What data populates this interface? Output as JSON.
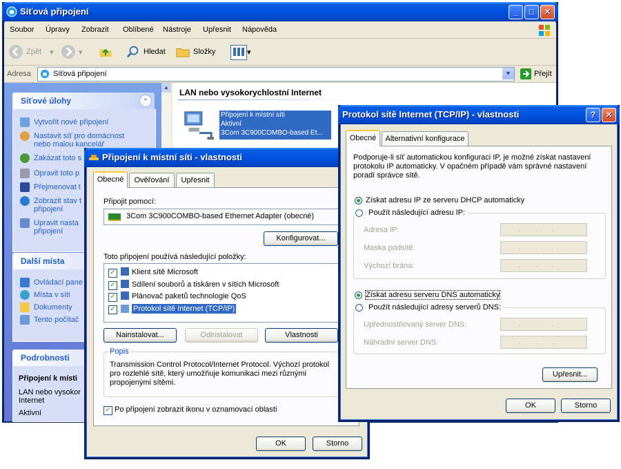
{
  "explorer": {
    "title": "Síťová připojení",
    "menu": [
      "Soubor",
      "Úpravy",
      "Zobrazit",
      "Oblíbené",
      "Nástroje",
      "Upřesnit",
      "Nápověda"
    ],
    "toolbar": {
      "back": "Zpět",
      "search": "Hledat",
      "folders": "Složky"
    },
    "address": {
      "label": "Adresa",
      "value": "Síťová připojení",
      "go": "Přejít"
    },
    "network_tasks": {
      "title": "Síťové úlohy",
      "items": [
        "Vytvořit nové připojení",
        "Nastavit síť pro domácnost",
        "nebo malou kancelář",
        "Zakázat toto s",
        "Opravit toto p",
        "Přejmenovat t",
        "Zobrazit stav t",
        "připojení",
        "Upravit nasta",
        "připojení"
      ]
    },
    "other_places": {
      "title": "Další místa",
      "items": [
        "Ovládací pane",
        "Místa v síti",
        "Dokumenty",
        "Tento počítač"
      ]
    },
    "details": {
      "title": "Podrobnosti",
      "name": "Připojení k místi",
      "lines": [
        "LAN nebo vysokor",
        "Internet",
        "Aktivní"
      ]
    },
    "section_title": "LAN nebo vysokorychlostní Internet",
    "connection": {
      "name": "Připojení k místní síti",
      "status": "Aktivní",
      "device": "3Com 3C900COMBO-based Et..."
    }
  },
  "lan_dialog": {
    "title": "Připojení k místní síti - vlastnosti",
    "tabs": [
      "Obecné",
      "Ověřování",
      "Upřesnit"
    ],
    "connect_using_label": "Připojit pomocí:",
    "adapter": "3Com 3C900COMBO-based Ethernet Adapter (obecné)",
    "configure": "Konfigurovat...",
    "items_label": "Toto připojení používá následující položky:",
    "items": [
      "Klient sítě Microsoft",
      "Sdílení souborů a tiskáren v sítích Microsoft",
      "Plánovač paketů technologie QoS",
      "Protokol sítě Internet (TCP/IP)"
    ],
    "install": "Nainstalovat...",
    "uninstall": "Odinstalovat",
    "properties": "Vlastnosti",
    "description_label": "Popis",
    "description": "Transmission Control Protocol/Internet Protocol. Výchozí protokol pro rozlehlé sítě, který umožňuje komunikaci mezi různými propojenými sítěmi.",
    "show_icon": "Po připojení zobrazit ikonu v oznamovací oblasti",
    "ok": "OK",
    "cancel": "Storno"
  },
  "tcpip_dialog": {
    "title": "Protokol sítě Internet (TCP/IP) - vlastnosti",
    "tabs": [
      "Obecné",
      "Alternativní konfigurace"
    ],
    "intro": "Podporuje-li síť automatickou konfiguraci IP, je možné získat nastavení protokolu IP automaticky. V opačném případě vám správné nastavení poradí správce sítě.",
    "ip_auto": "Získat adresu IP ze serveru DHCP automaticky",
    "ip_manual": "Použít následující adresu IP:",
    "ip_address": "Adresa IP:",
    "subnet": "Maska podsítě:",
    "gateway": "Výchozí brána:",
    "dns_auto": "Získat adresu serveru DNS automaticky",
    "dns_manual": "Použít následující adresy serverů DNS:",
    "dns_preferred": "Upřednostňovaný server DNS:",
    "dns_alternate": "Náhradní server DNS:",
    "ip_placeholder": "...",
    "advanced": "Upřesnit...",
    "ok": "OK",
    "cancel": "Storno"
  }
}
